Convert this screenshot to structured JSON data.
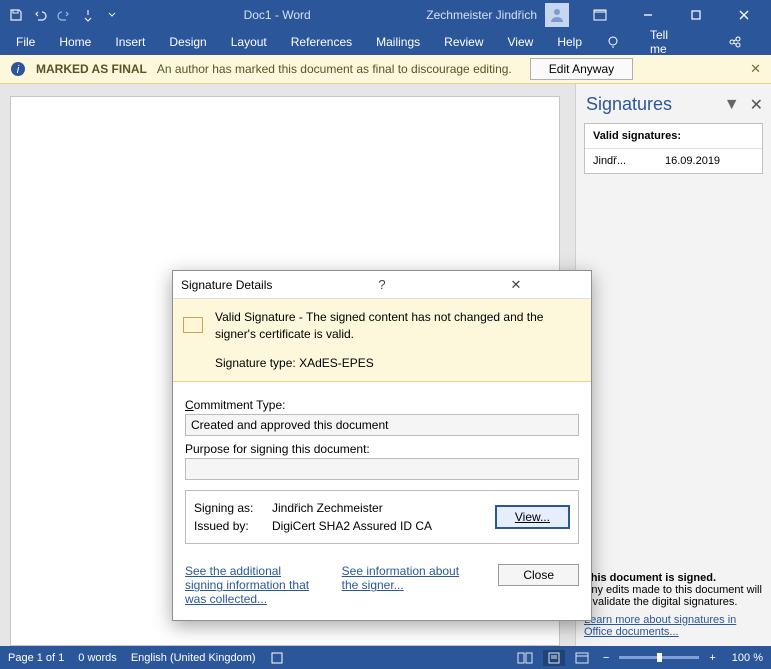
{
  "titlebar": {
    "doc_title": "Doc1 - Word",
    "user_name": "Zechmeister Jindřich"
  },
  "ribbon": {
    "tabs": [
      "File",
      "Home",
      "Insert",
      "Design",
      "Layout",
      "References",
      "Mailings",
      "Review",
      "View",
      "Help"
    ],
    "tell_me": "Tell me",
    "share": "Share"
  },
  "info_bar": {
    "badge": "MARKED AS FINAL",
    "msg": "An author has marked this document as final to discourage editing.",
    "edit_btn": "Edit Anyway"
  },
  "side": {
    "title": "Signatures",
    "valid_header": "Valid signatures:",
    "sig_name": "Jindř...",
    "sig_date": "16.09.2019",
    "signed_msg_h": "This document is signed.",
    "signed_msg": "Any edits made to this document will invalidate the digital signatures.",
    "link": "Learn more about signatures in Office documents..."
  },
  "dialog": {
    "title": "Signature Details",
    "info1": "Valid Signature - The signed content has not changed and the signer's certificate is valid.",
    "info2_lbl": "Signature type: ",
    "info2_val": "XAdES-EPES",
    "commit_lbl": "Commitment Type:",
    "commit_val": "Created and approved this document",
    "purpose_lbl": "Purpose for signing this document:",
    "purpose_val": "",
    "signing_as_lbl": "Signing as:",
    "signing_as_val": "Jindřich Zechmeister",
    "issued_lbl": "Issued by:",
    "issued_val": "DigiCert SHA2 Assured ID CA",
    "view_btn": "View...",
    "link1": "See the additional signing information that was collected...",
    "link2": "See information about the signer...",
    "close_btn": "Close"
  },
  "status": {
    "page": "Page 1 of 1",
    "words": "0 words",
    "lang": "English (United Kingdom)",
    "zoom": "100 %"
  }
}
